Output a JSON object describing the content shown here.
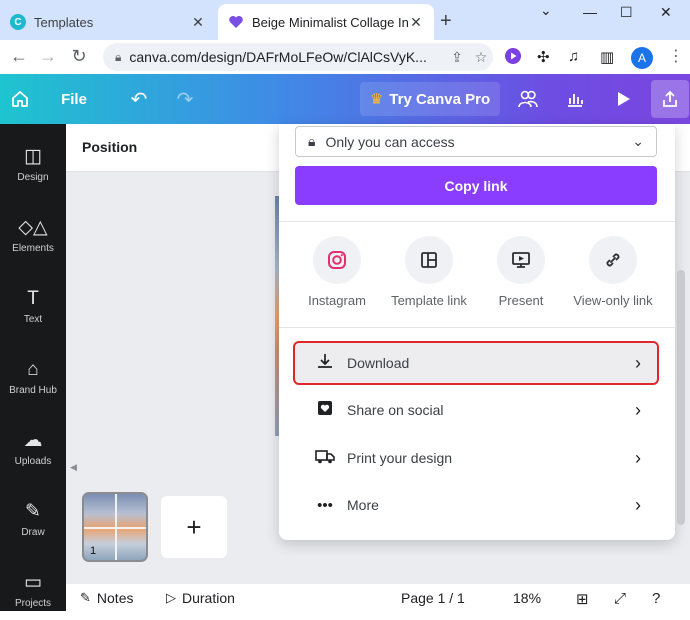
{
  "browser": {
    "tabs": [
      {
        "title": "Templates",
        "active": false
      },
      {
        "title": "Beige Minimalist Collage Ins",
        "active": true
      }
    ],
    "url": "canva.com/design/DAFrMoLFeOw/ClAlCsVyK...",
    "avatar_letter": "A"
  },
  "header": {
    "file_label": "File",
    "try_pro_label": "Try Canva Pro"
  },
  "rail": {
    "items": [
      {
        "label": "Design",
        "icon": "design-icon"
      },
      {
        "label": "Elements",
        "icon": "elements-icon"
      },
      {
        "label": "Text",
        "icon": "text-icon"
      },
      {
        "label": "Brand Hub",
        "icon": "brand-hub-icon"
      },
      {
        "label": "Uploads",
        "icon": "uploads-icon"
      },
      {
        "label": "Draw",
        "icon": "draw-icon"
      },
      {
        "label": "Projects",
        "icon": "projects-icon"
      }
    ]
  },
  "toolbar": {
    "position_label": "Position"
  },
  "pages": {
    "thumb_number": "1"
  },
  "footer": {
    "notes_label": "Notes",
    "duration_label": "Duration",
    "page_indicator": "Page 1 / 1",
    "zoom": "18%"
  },
  "share_panel": {
    "access_label": "Only you can access",
    "copy_link_label": "Copy link",
    "options": [
      {
        "label": "Instagram",
        "icon": "instagram-icon"
      },
      {
        "label": "Template link",
        "icon": "template-link-icon"
      },
      {
        "label": "Present",
        "icon": "present-icon"
      },
      {
        "label": "View-only link",
        "icon": "view-only-link-icon"
      }
    ],
    "menu": [
      {
        "label": "Download",
        "icon": "download-icon",
        "highlighted": true
      },
      {
        "label": "Share on social",
        "icon": "heart-icon",
        "highlighted": false
      },
      {
        "label": "Print your design",
        "icon": "truck-icon",
        "highlighted": false
      },
      {
        "label": "More",
        "icon": "more-icon",
        "highlighted": false
      }
    ]
  },
  "colors": {
    "copy_link_bg": "#8b3dff",
    "highlight_border": "#e0272b",
    "rail_bg": "#18191b",
    "header_gradient_start": "#1ec4cf",
    "header_gradient_end": "#7a46e0"
  }
}
